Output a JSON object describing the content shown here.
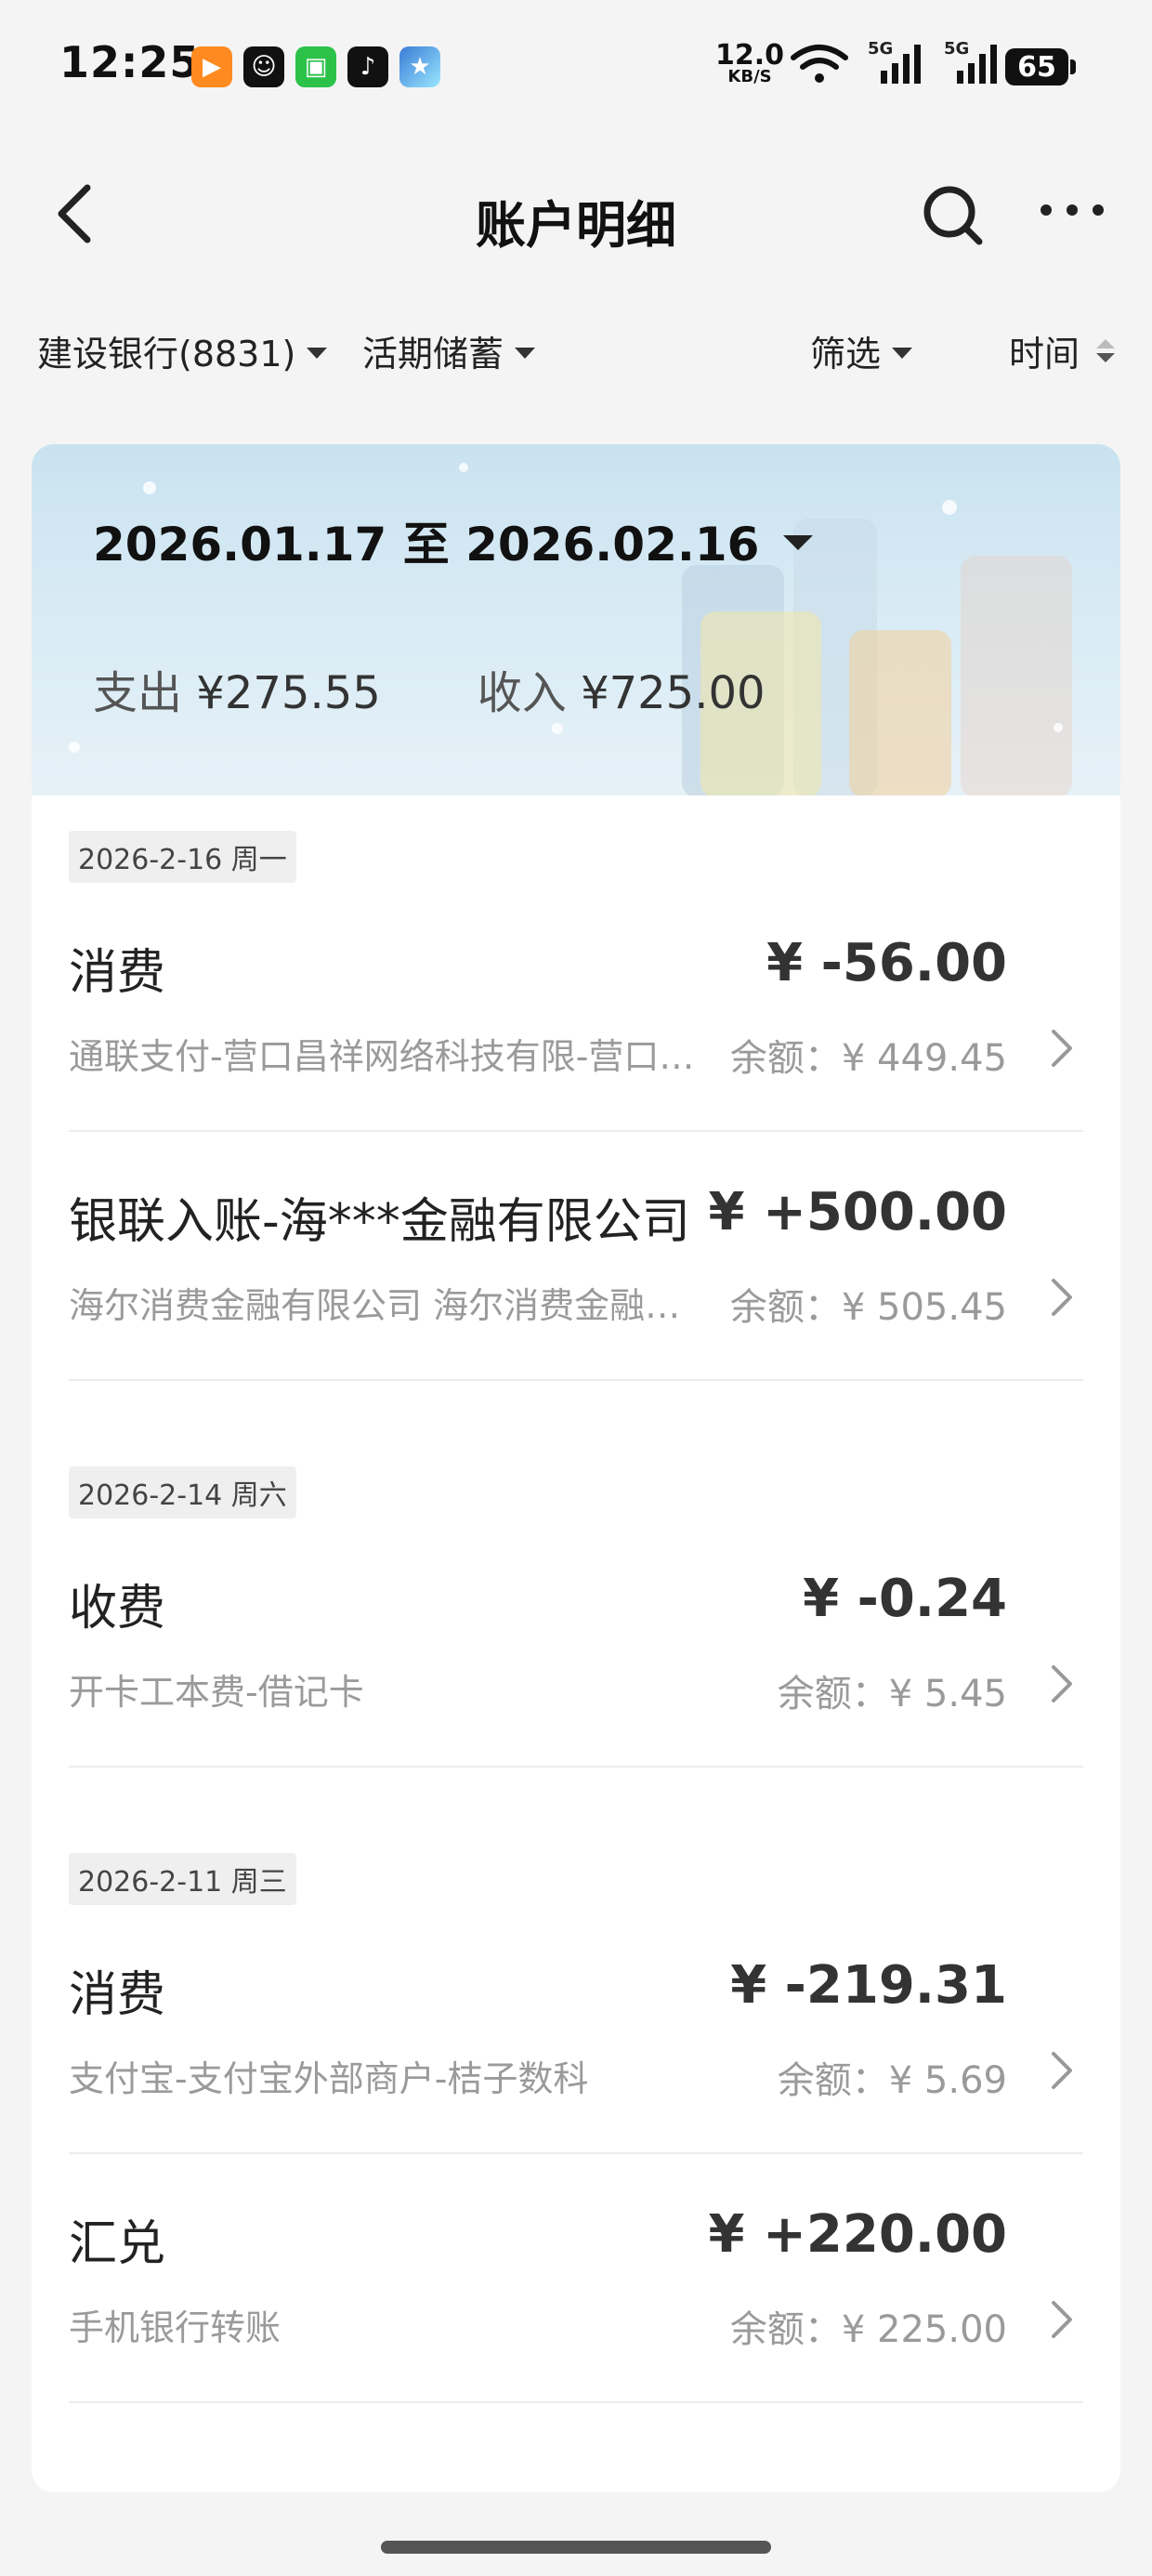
{
  "status_bar": {
    "time": "12:25",
    "net_speed_value": "12.0",
    "net_speed_unit": "KB/S",
    "signal_label_1": "5G",
    "signal_label_2": "5G",
    "battery": "65"
  },
  "header": {
    "title": "账户明细"
  },
  "filters": {
    "account": "建设银行(8831)",
    "type": "活期储蓄",
    "filter": "筛选",
    "sort": "时间"
  },
  "summary": {
    "date_range": "2026.01.17 至 2026.02.16",
    "expense_label": "支出",
    "expense_value": "¥275.55",
    "income_label": "收入",
    "income_value": "¥725.00"
  },
  "groups": [
    {
      "date": "2026-2-16 周一",
      "transactions": [
        {
          "title": "消费",
          "amount": "¥ -56.00",
          "desc": "通联支付-营口昌祥网络科技有限-营口…",
          "balance": "余额：¥ 449.45"
        },
        {
          "title": "银联入账-海***金融有限公司",
          "amount": "¥ +500.00",
          "desc": "海尔消费金融有限公司 海尔消费金融有…",
          "balance": "余额：¥ 505.45"
        }
      ]
    },
    {
      "date": "2026-2-14 周六",
      "transactions": [
        {
          "title": "收费",
          "amount": "¥ -0.24",
          "desc": "开卡工本费-借记卡",
          "balance": "余额：¥ 5.45"
        }
      ]
    },
    {
      "date": "2026-2-11 周三",
      "transactions": [
        {
          "title": "消费",
          "amount": "¥ -219.31",
          "desc": "支付宝-支付宝外部商户-桔子数科",
          "balance": "余额：¥ 5.69"
        },
        {
          "title": "汇兑",
          "amount": "¥ +220.00",
          "desc": "手机银行转账",
          "balance": "余额：¥ 225.00"
        }
      ]
    }
  ],
  "icons": {
    "back": "back-arrow-icon",
    "search": "search-icon",
    "more": "more-dots-icon",
    "chevron": "chevron-right-icon"
  }
}
